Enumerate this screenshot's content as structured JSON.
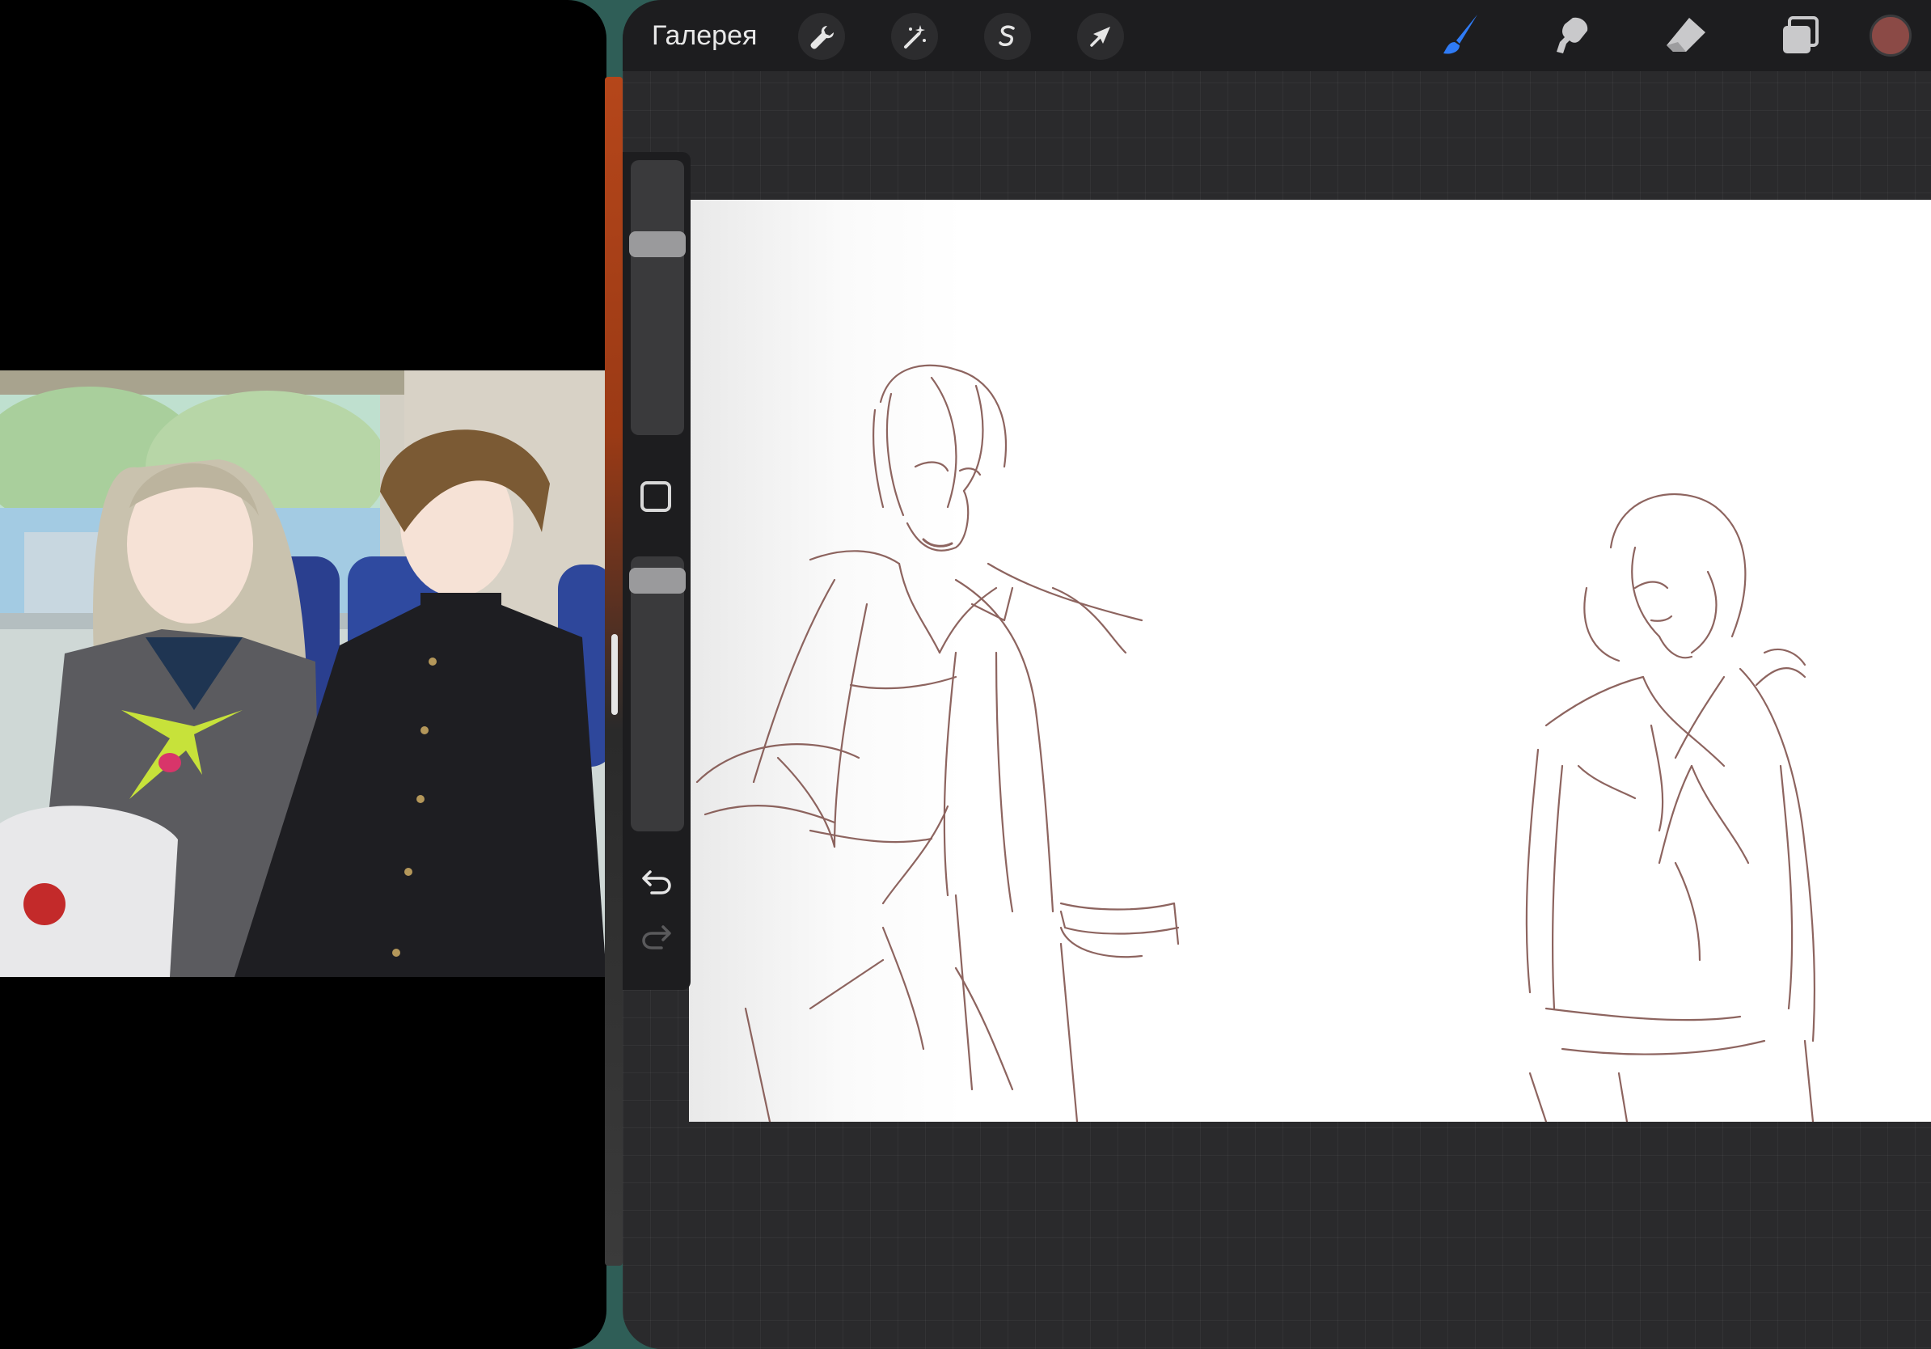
{
  "top_bar": {
    "gallery_label": "Галерея",
    "tools_left": [
      "wrench-icon",
      "magic-wand-icon",
      "selection-icon",
      "transform-arrow-icon"
    ],
    "tools_right": [
      "brush-icon",
      "smudge-icon",
      "eraser-icon",
      "layers-icon"
    ],
    "active_tool": "brush-icon",
    "accent_color": "#2f7bf5",
    "current_color": "#8b4a46"
  },
  "sidebar": {
    "brush_size_level": 0.28,
    "opacity_level": 0.06,
    "icons": [
      "modify-square-icon",
      "undo-icon",
      "redo-icon"
    ]
  },
  "reference_video": {
    "description_icons": [
      "train-window",
      "girl-sailor-uniform",
      "boy-gakuran"
    ]
  },
  "colors": {
    "sketch_stroke": "#7a4a44",
    "toolbar_bg": "#1d1d1f",
    "canvas_bg": "#ffffff",
    "workspace_bg": "#2a2a2c"
  }
}
